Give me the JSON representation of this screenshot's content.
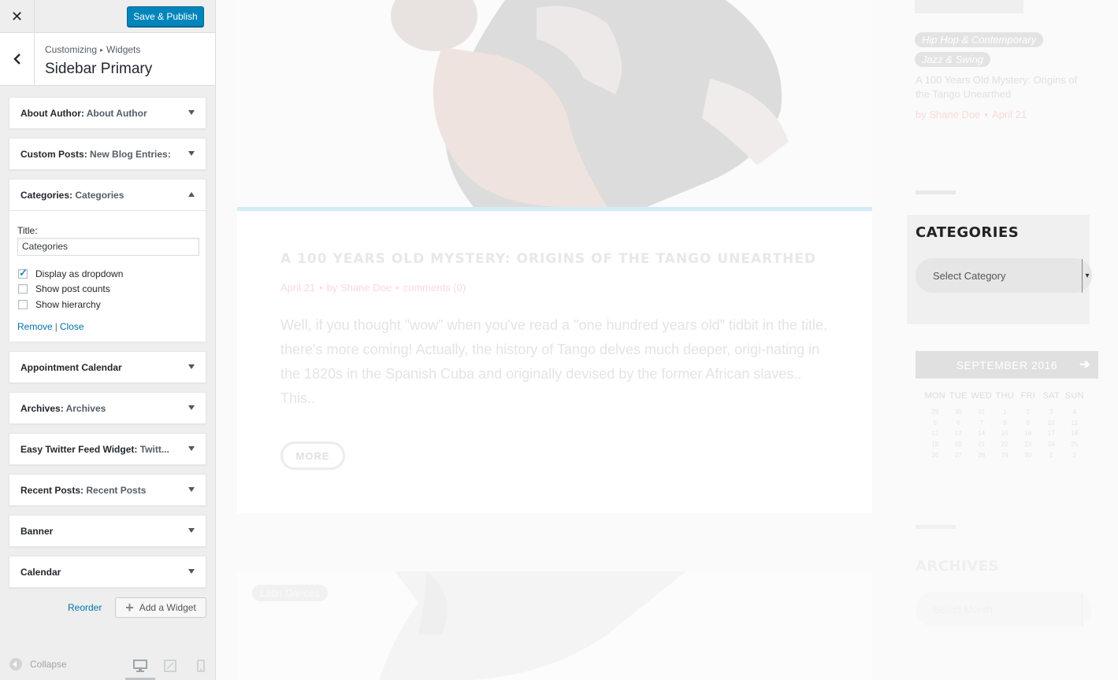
{
  "customizer": {
    "close_label": "✕",
    "save_label": "Save & Publish",
    "breadcrumb": [
      "Customizing",
      "Widgets"
    ],
    "breadcrumb_sep": "▸",
    "section_title": "Sidebar Primary",
    "widgets": [
      {
        "name": "About Author",
        "sub": "About Author",
        "expanded": false
      },
      {
        "name": "Custom Posts",
        "sub": "New Blog Entries:",
        "expanded": false
      },
      {
        "name": "Categories",
        "sub": "Categories",
        "expanded": true
      },
      {
        "name": "Appointment Calendar",
        "sub": "",
        "expanded": false
      },
      {
        "name": "Archives",
        "sub": "Archives",
        "expanded": false
      },
      {
        "name": "Easy Twitter Feed Widget",
        "sub": "Twitt...",
        "expanded": false
      },
      {
        "name": "Recent Posts",
        "sub": "Recent Posts",
        "expanded": false
      },
      {
        "name": "Banner",
        "sub": "",
        "expanded": false
      },
      {
        "name": "Calendar",
        "sub": "",
        "expanded": false
      }
    ],
    "categories_form": {
      "title_label": "Title:",
      "title_value": "Categories",
      "options": [
        {
          "label": "Display as dropdown",
          "checked": true
        },
        {
          "label": "Show post counts",
          "checked": false
        },
        {
          "label": "Show hierarchy",
          "checked": false
        }
      ],
      "remove_label": "Remove",
      "separator": "|",
      "close_label": "Close"
    },
    "reorder_label": "Reorder",
    "add_widget_label": "Add a Widget",
    "collapse_label": "Collapse"
  },
  "preview": {
    "post": {
      "title": "A 100 YEARS OLD MYSTERY: ORIGINS OF THE TANGO UNEARTHED",
      "date": "April 21",
      "author": "by Shane Doe",
      "comments": "comments (0)",
      "excerpt": "Well, if you thought \"wow\" when you've read a \"one hundred years old\" tidbit in the title, there's more coming! Actually, the history of Tango delves much deeper, origi-nating in the 1820s in the Spanish Cuba and originally devised by the former African slaves.. This..",
      "more_label": "MORE"
    },
    "post2_tag": "Latin Dances",
    "sidebar": {
      "tags": [
        "Hip Hop & Contemporary",
        "Jazz & Swing"
      ],
      "recent_title": "A 100 Years Old Mystery: Origins of the Tango Unearthed",
      "recent_author": "by Shane Doe",
      "recent_date": "April 21",
      "categories_heading": "CATEGORIES",
      "categories_select": "Select Category",
      "calendar_month": "SEPTEMBER 2016",
      "calendar_days": [
        "MON",
        "TUE",
        "WED",
        "THU",
        "FRI",
        "SAT",
        "SUN"
      ],
      "calendar_weeks": [
        [
          "29",
          "30",
          "31",
          "1",
          "2",
          "3",
          "4"
        ],
        [
          "5",
          "6",
          "7",
          "8",
          "9",
          "10",
          "11"
        ],
        [
          "12",
          "13",
          "14",
          "15",
          "16",
          "17",
          "18"
        ],
        [
          "19",
          "20",
          "21",
          "22",
          "23",
          "24",
          "25"
        ],
        [
          "26",
          "27",
          "28",
          "29",
          "30",
          "1",
          "2"
        ]
      ],
      "archives_heading": "ARCHIVES",
      "archives_select": "Select Month"
    }
  },
  "colors": {
    "primary_button": "#0085ba",
    "link": "#0073aa",
    "accent_pink": "#fadada"
  }
}
